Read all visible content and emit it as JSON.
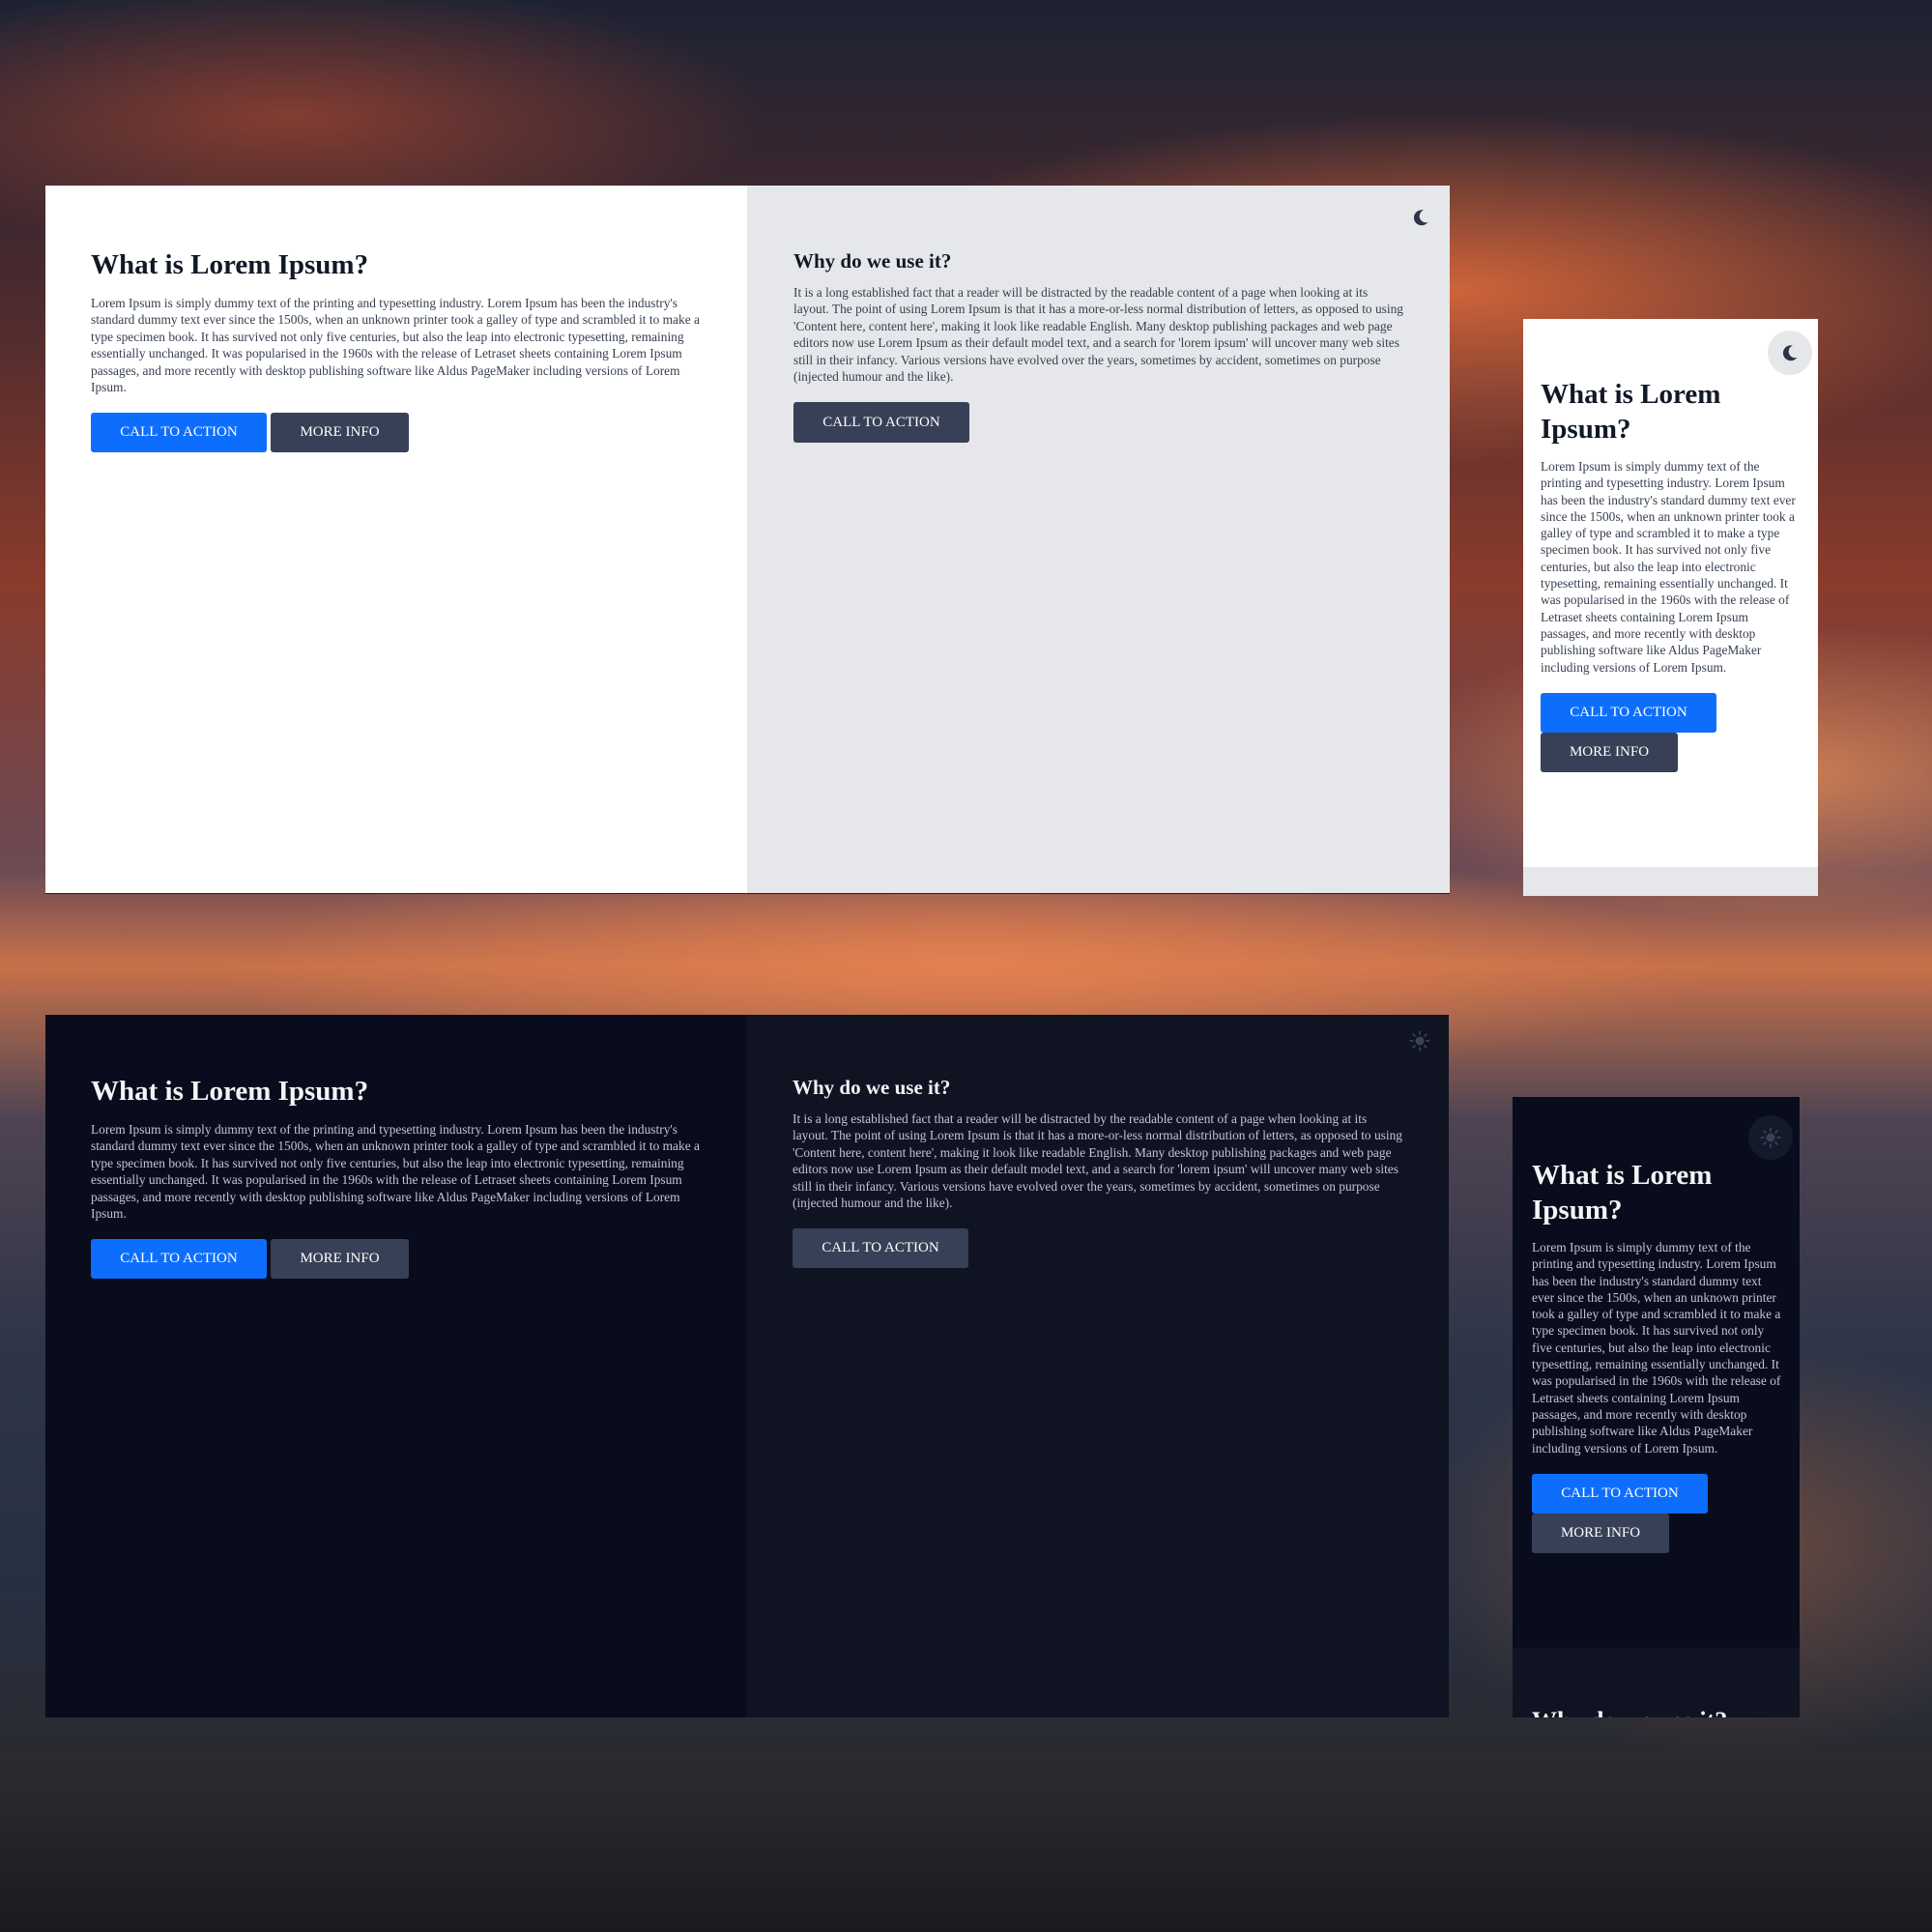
{
  "desktop_light": {
    "left": {
      "title": "What is Lorem Ipsum?",
      "body": "Lorem Ipsum is simply dummy text of the printing and typesetting industry. Lorem Ipsum has been the industry's standard dummy text ever since the 1500s, when an unknown printer took a galley of type and scrambled it to make a type specimen book. It has survived not only five centuries, but also the leap into electronic typesetting, remaining essentially unchanged. It was popularised in the 1960s with the release of Letraset sheets containing Lorem Ipsum passages, and more recently with desktop publishing software like Aldus PageMaker including versions of Lorem Ipsum.",
      "cta_label": "CALL TO ACTION",
      "more_label": "MORE INFO"
    },
    "right": {
      "title": "Why do we use it?",
      "body": "It is a long established fact that a reader will be distracted by the readable content of a page when looking at its layout. The point of using Lorem Ipsum is that it has a more-or-less normal distribution of letters, as opposed to using 'Content here, content here', making it look like readable English. Many desktop publishing packages and web page editors now use Lorem Ipsum as their default model text, and a search for 'lorem ipsum' will uncover many web sites still in their infancy. Various versions have evolved over the years, sometimes by accident, sometimes on purpose (injected humour and the like).",
      "cta_label": "CALL TO ACTION"
    },
    "theme_icon": "moon-icon"
  },
  "mobile_light": {
    "title": "What is Lorem Ipsum?",
    "body": "Lorem Ipsum is simply dummy text of the printing and typesetting industry. Lorem Ipsum has been the industry's standard dummy text ever since the 1500s, when an unknown printer took a galley of type and scrambled it to make a type specimen book. It has survived not only five centuries, but also the leap into electronic typesetting, remaining essentially unchanged. It was popularised in the 1960s with the release of Letraset sheets containing Lorem Ipsum passages, and more recently with desktop publishing software like Aldus PageMaker including versions of Lorem Ipsum.",
    "cta_label": "CALL TO ACTION",
    "more_label": "MORE INFO",
    "theme_icon": "moon-icon"
  },
  "desktop_dark": {
    "left": {
      "title": "What is Lorem Ipsum?",
      "body": "Lorem Ipsum is simply dummy text of the printing and typesetting industry. Lorem Ipsum has been the industry's standard dummy text ever since the 1500s, when an unknown printer took a galley of type and scrambled it to make a type specimen book. It has survived not only five centuries, but also the leap into electronic typesetting, remaining essentially unchanged. It was popularised in the 1960s with the release of Letraset sheets containing Lorem Ipsum passages, and more recently with desktop publishing software like Aldus PageMaker including versions of Lorem Ipsum.",
      "cta_label": "CALL TO ACTION",
      "more_label": "MORE INFO"
    },
    "right": {
      "title": "Why do we use it?",
      "body": "It is a long established fact that a reader will be distracted by the readable content of a page when looking at its layout. The point of using Lorem Ipsum is that it has a more-or-less normal distribution of letters, as opposed to using 'Content here, content here', making it look like readable English. Many desktop publishing packages and web page editors now use Lorem Ipsum as their default model text, and a search for 'lorem ipsum' will uncover many web sites still in their infancy. Various versions have evolved over the years, sometimes by accident, sometimes on purpose (injected humour and the like).",
      "cta_label": "CALL TO ACTION"
    },
    "theme_icon": "sun-icon"
  },
  "mobile_dark": {
    "title": "What is Lorem Ipsum?",
    "body": "Lorem Ipsum is simply dummy text of the printing and typesetting industry. Lorem Ipsum has been the industry's standard dummy text ever since the 1500s, when an unknown printer took a galley of type and scrambled it to make a type specimen book. It has survived not only five centuries, but also the leap into electronic typesetting, remaining essentially unchanged. It was popularised in the 1960s with the release of Letraset sheets containing Lorem Ipsum passages, and more recently with desktop publishing software like Aldus PageMaker including versions of Lorem Ipsum.",
    "cta_label": "CALL TO ACTION",
    "more_label": "MORE INFO",
    "next_title": "Why do we use it?",
    "theme_icon": "sun-icon"
  },
  "colors": {
    "primary": "#0d6efd",
    "secondary": "#374056",
    "light_left_bg": "#ffffff",
    "light_right_bg": "#e6e7eb",
    "dark_left_bg": "#090c1c",
    "dark_right_bg": "#0f1322",
    "light_text": "#111827",
    "dark_text": "#f3f4f6"
  }
}
